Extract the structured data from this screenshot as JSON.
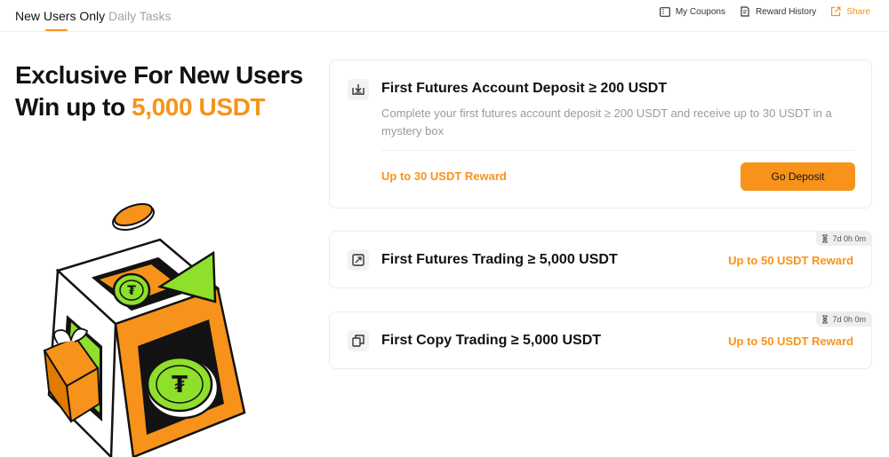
{
  "tabs": [
    {
      "label": "New Users Only",
      "active": true
    },
    {
      "label": "Daily Tasks",
      "active": false
    }
  ],
  "top_actions": [
    {
      "label": "My Coupons",
      "icon": "coupon-icon"
    },
    {
      "label": "Reward History",
      "icon": "history-icon"
    },
    {
      "label": "Share",
      "icon": "share-icon"
    }
  ],
  "hero": {
    "line1": "Exclusive For New Users",
    "line2_prefix": "Win up to ",
    "line2_accent": "5,000 USDT"
  },
  "tasks": [
    {
      "title": "First Futures Account Deposit ≥ 200 USDT",
      "description": "Complete your first futures account deposit ≥ 200 USDT and receive up to 30 USDT in a mystery box",
      "reward": "Up to 30 USDT Reward",
      "button": "Go Deposit",
      "icon": "deposit-icon"
    },
    {
      "title": "First Futures Trading ≥ 5,000 USDT",
      "reward": "Up to 50 USDT Reward",
      "timer": "7d 0h 0m",
      "icon": "futures-trade-icon"
    },
    {
      "title": "First Copy Trading ≥ 5,000 USDT",
      "reward": "Up to 50 USDT Reward",
      "timer": "7d 0h 0m",
      "icon": "copy-trade-icon"
    }
  ],
  "colors": {
    "accent": "#f7931a",
    "green": "#8ee02a",
    "text": "#121212",
    "muted": "#9a9a9a"
  }
}
